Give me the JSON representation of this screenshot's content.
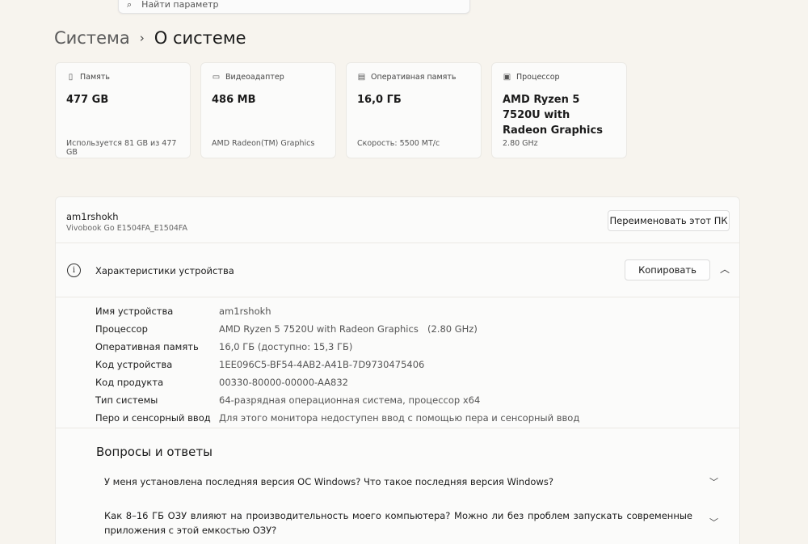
{
  "search": {
    "placeholder": "Найти параметр"
  },
  "breadcrumb": {
    "parent": "Система",
    "separator": "›",
    "current": "О системе"
  },
  "cards": [
    {
      "icon": "storage-icon",
      "label": "Память",
      "value": "477 GB",
      "sub": "Используется 81 GB из 477 GB"
    },
    {
      "icon": "gpu-icon",
      "label": "Видеоадаптер",
      "value": "486 MB",
      "sub": "AMD Radeon(TM) Graphics"
    },
    {
      "icon": "ram-icon",
      "label": "Оперативная память",
      "value": "16,0 ГБ",
      "sub": "Скорость: 5500 МТ/с"
    },
    {
      "icon": "cpu-icon",
      "label": "Процессор",
      "value": "AMD Ryzen 5 7520U with Radeon Graphics",
      "sub": "2.80 GHz"
    }
  ],
  "pc": {
    "name": "am1rshokh",
    "model": "Vivobook Go E1504FA_E1504FA",
    "rename_label": "Переименовать этот ПК"
  },
  "specs": {
    "title": "Характеристики устройства",
    "copy_label": "Копировать",
    "rows": [
      {
        "label": "Имя устройства",
        "value": "am1rshokh"
      },
      {
        "label": "Процессор",
        "value": "AMD Ryzen 5 7520U with Radeon Graphics",
        "extra": "(2.80 GHz)"
      },
      {
        "label": "Оперативная память",
        "value": "16,0 ГБ (доступно: 15,3 ГБ)"
      },
      {
        "label": "Код устройства",
        "value": "1EE096C5-BF54-4AB2-A41B-7D9730475406"
      },
      {
        "label": "Код продукта",
        "value": "00330-80000-00000-AA832"
      },
      {
        "label": "Тип системы",
        "value": "64-разрядная операционная система, процессор x64"
      },
      {
        "label": "Перо и сенсорный ввод",
        "value": "Для этого монитора недоступен ввод с помощью пера и сенсорный ввод"
      }
    ]
  },
  "faq": {
    "title": "Вопросы и ответы",
    "items": [
      {
        "question": "У меня установлена последняя версия ОС Windows? Что такое последняя версия Windows?"
      },
      {
        "question": "Как 8–16 ГБ ОЗУ влияют на производительность моего компьютера? Можно ли без проблем запускать современные приложения с этой емкостью ОЗУ?"
      }
    ]
  },
  "colors": {
    "background": "#f7f4ee",
    "card": "#fbfbfa",
    "border": "#ebe9e4"
  }
}
